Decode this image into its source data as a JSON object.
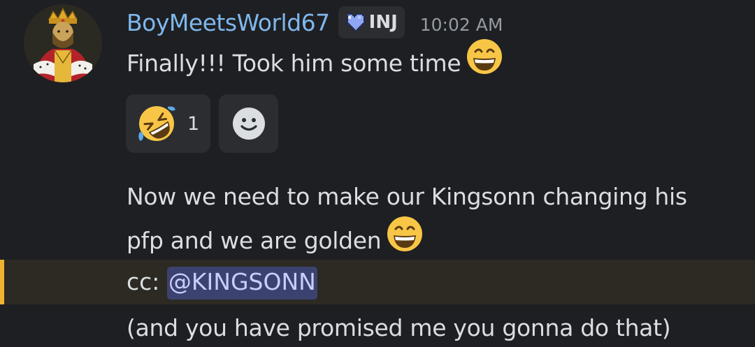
{
  "message": {
    "author": "BoyMeetsWorld67",
    "author_color": "#7fb8ee",
    "avatar": "king-avatar",
    "tag": {
      "icon": "pixel-heart-icon",
      "label": "INJ"
    },
    "timestamp": "10:02 AM",
    "first_line": "Finally!!! Took him some time",
    "first_line_emoji": "grinning-face-emoji",
    "reactions": [
      {
        "emoji": "rolling-on-floor-laughing-emoji",
        "count": "1"
      },
      {
        "emoji": "add-reaction-icon"
      }
    ],
    "second_paragraph": {
      "line1": "Now we need to make our Kingsonn changing his",
      "line2": "pfp and we are golden",
      "emoji": "grinning-face-emoji"
    },
    "mention_line": {
      "prefix": "cc: ",
      "mention": "@KINGSONN",
      "highlight_color": "#f0b232"
    },
    "last_line": "(and you have promised me you gonna do that)"
  }
}
